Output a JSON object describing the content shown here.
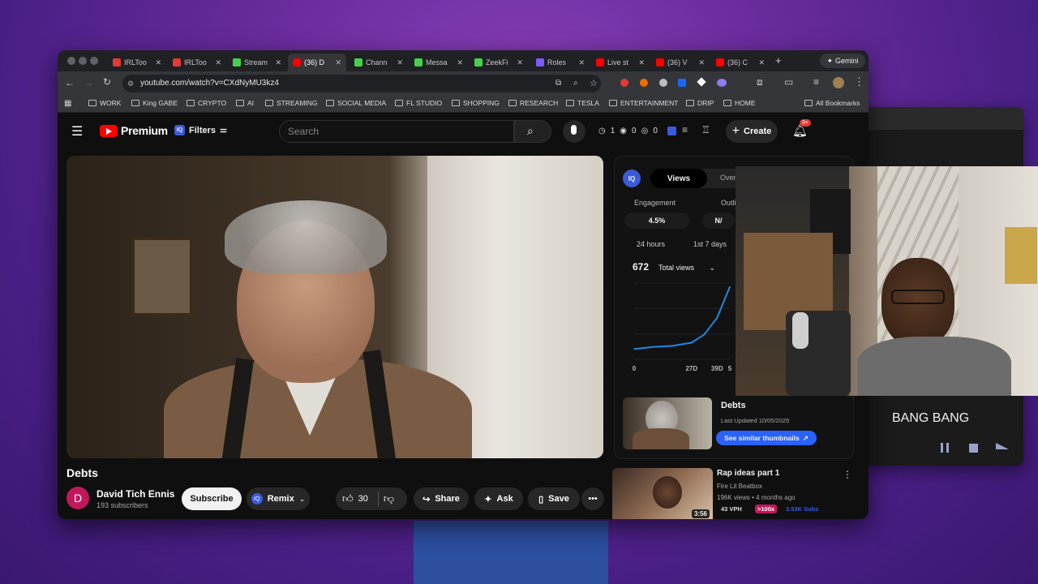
{
  "browser": {
    "tabs": [
      {
        "label": "IRLToo",
        "color": "#e53935"
      },
      {
        "label": "IRLToo",
        "color": "#e53935"
      },
      {
        "label": "Stream",
        "color": "#43d34a"
      },
      {
        "label": "(36) D",
        "color": "#ff0000",
        "active": true
      },
      {
        "label": "Chann",
        "color": "#43d34a"
      },
      {
        "label": "Messa",
        "color": "#43d34a"
      },
      {
        "label": "ZeekFi",
        "color": "#43d34a"
      },
      {
        "label": "Roles",
        "color": "#7c5cff"
      },
      {
        "label": "Live st",
        "color": "#ff0000"
      },
      {
        "label": "(36) V",
        "color": "#ff0000"
      },
      {
        "label": "(36) C",
        "color": "#ff0000"
      }
    ],
    "new_tab": "+",
    "gemini": "Gemini",
    "url": "youtube.com/watch?v=CXdNyMU3kz4",
    "bookmarks": [
      "WORK",
      "King GABE",
      "CRYPTO",
      "AI",
      "STREAMING",
      "SOCIAL MEDIA",
      "FL STUDIO",
      "SHOPPING",
      "RESEARCH",
      "TESLA",
      "ENTERTAINMENT",
      "DRIP",
      "HOME"
    ],
    "all_bookmarks": "All Bookmarks"
  },
  "youtube": {
    "logo_text": "Premium",
    "filters_label": "Filters",
    "search_placeholder": "Search",
    "counters": {
      "a": "1",
      "b": "0",
      "c": "0"
    },
    "create_label": "Create",
    "notif_badge": "9+",
    "video": {
      "title": "Debts",
      "channel": "David Tich Ennis",
      "channel_initial": "D",
      "subscribers": "193 subscribers",
      "subscribe_label": "Subscribe",
      "remix_label": "Remix",
      "likes": "30",
      "share_label": "Share",
      "ask_label": "Ask",
      "save_label": "Save"
    }
  },
  "iq_panel": {
    "badge": "IQ",
    "tab_views": "Views",
    "tab_overview": "Overv",
    "engagement_label": "Engagement",
    "engagement_value": "4.5%",
    "outlier_label": "Outli",
    "outlier_value": "N/",
    "range_24h": "24 hours",
    "range_7d": "1st 7 days",
    "total_views_value": "672",
    "total_views_label": "Total views",
    "x_ticks": [
      "0",
      "27D",
      "39D",
      "5"
    ],
    "recommendation_1": {
      "title": "Debts",
      "updated": "Last Updated 10/05/2025",
      "button": "See similar thumbnails"
    },
    "recommendation_2": {
      "title": "Rap ideas part 1",
      "channel": "Fire Lit Beatbox",
      "meta": "196K views • 4 months ago",
      "duration": "3:56",
      "vph": "43 VPH",
      "multiplier": ">100x",
      "subs": "3.53K Subs"
    }
  },
  "side_window": {
    "now_playing": "BANG BANG"
  },
  "chart_data": {
    "type": "line",
    "x": [
      0,
      9,
      18,
      27,
      33,
      39,
      45
    ],
    "series": [
      {
        "values": [
          10,
          12,
          13,
          16,
          24,
          40,
          70
        ]
      }
    ],
    "xticks": [
      "0",
      "27D",
      "39D",
      "5"
    ]
  }
}
